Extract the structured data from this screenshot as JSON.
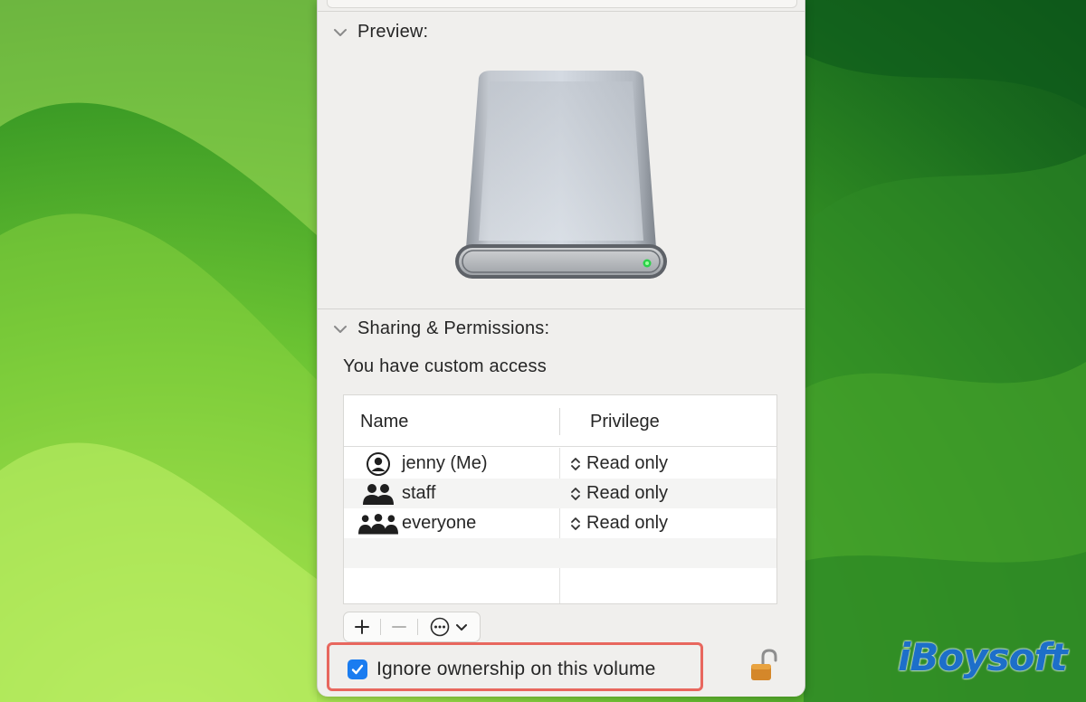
{
  "preview": {
    "title": "Preview:"
  },
  "sharing": {
    "title": "Sharing & Permissions:",
    "access_text": "You have custom access",
    "columns": {
      "name": "Name",
      "privilege": "Privilege"
    },
    "rows": [
      {
        "name": "jenny (Me)",
        "privilege": "Read only",
        "icon": "single-user-icon"
      },
      {
        "name": "staff",
        "privilege": "Read only",
        "icon": "group-icon"
      },
      {
        "name": "everyone",
        "privilege": "Read only",
        "icon": "everyone-icon"
      }
    ]
  },
  "toolbar": {
    "add": "+",
    "remove": "—"
  },
  "ignore_ownership": {
    "label": "Ignore ownership on this volume",
    "checked": true
  },
  "watermark": {
    "text": "iBoysoft"
  },
  "colors": {
    "accent": "#1a7cf0",
    "highlight": "#e8675e",
    "watermark": "#1d6fc9"
  }
}
